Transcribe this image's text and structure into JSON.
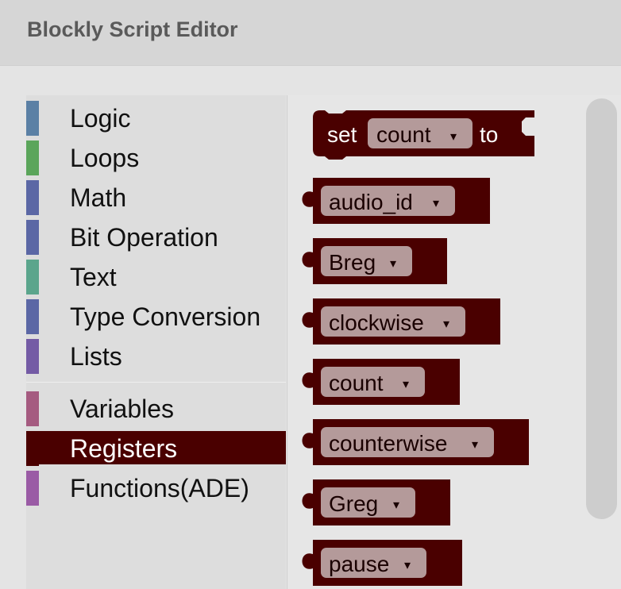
{
  "window": {
    "title": "Blockly Script Editor"
  },
  "toolbox": {
    "categories": [
      {
        "label": "Logic",
        "color": "#5b80a5"
      },
      {
        "label": "Loops",
        "color": "#5ba55b"
      },
      {
        "label": "Math",
        "color": "#5b67a5"
      },
      {
        "label": "Bit Operation",
        "color": "#5b67a5"
      },
      {
        "label": "Text",
        "color": "#5ba58c"
      },
      {
        "label": "Type Conversion",
        "color": "#5b67a5"
      },
      {
        "label": "Lists",
        "color": "#745ba5"
      },
      {
        "label": "Variables",
        "color": "#a55b80"
      },
      {
        "label": "Registers",
        "color": "#4a0000",
        "selected": true
      },
      {
        "label": "Functions(ADE)",
        "color": "#9a5ba5"
      }
    ]
  },
  "flyout": {
    "block_color": "#4a0000",
    "field_color": "#b49a9a",
    "set_block": {
      "keyword": "set",
      "variable": "count",
      "connector": "to",
      "dropdown_arrow": "▾"
    },
    "register_blocks": [
      {
        "variable": "audio_id",
        "dropdown_arrow": "▾"
      },
      {
        "variable": "Breg",
        "dropdown_arrow": "▾"
      },
      {
        "variable": "clockwise",
        "dropdown_arrow": "▾"
      },
      {
        "variable": "count",
        "dropdown_arrow": "▾"
      },
      {
        "variable": "counterwise",
        "dropdown_arrow": "▾"
      },
      {
        "variable": "Greg",
        "dropdown_arrow": "▾"
      },
      {
        "variable": "pause",
        "dropdown_arrow": "▾"
      }
    ]
  }
}
